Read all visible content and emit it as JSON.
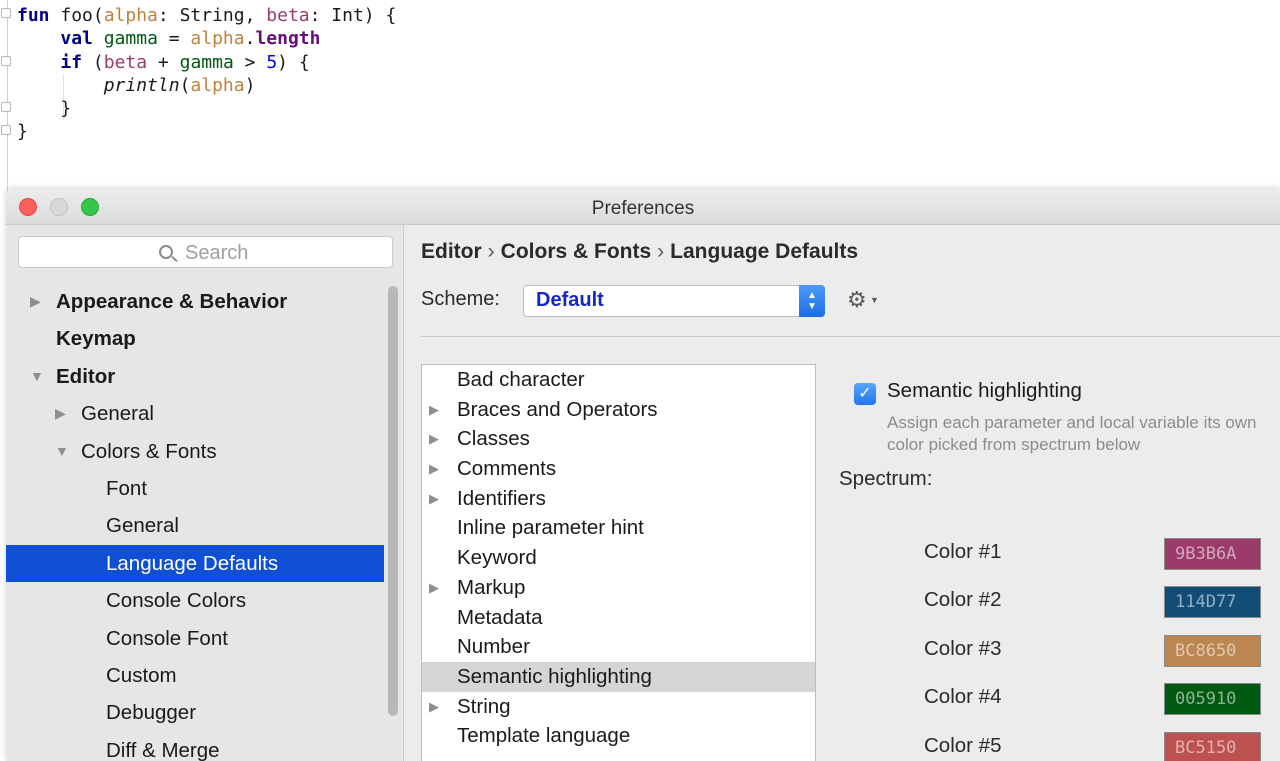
{
  "code": {
    "lines": [
      [
        {
          "t": "fun",
          "c": "kw"
        },
        {
          "t": " foo(",
          "c": ""
        },
        {
          "t": "alpha",
          "c": "p1"
        },
        {
          "t": ": String, ",
          "c": ""
        },
        {
          "t": "beta",
          "c": "p2"
        },
        {
          "t": ": Int) {",
          "c": ""
        }
      ],
      [
        {
          "t": "    ",
          "c": ""
        },
        {
          "t": "val",
          "c": "kw"
        },
        {
          "t": " ",
          "c": ""
        },
        {
          "t": "gamma",
          "c": "v3"
        },
        {
          "t": " = ",
          "c": ""
        },
        {
          "t": "alpha",
          "c": "p1"
        },
        {
          "t": ".",
          "c": ""
        },
        {
          "t": "length",
          "c": "fn"
        }
      ],
      [
        {
          "t": "    ",
          "c": ""
        },
        {
          "t": "if",
          "c": "kw"
        },
        {
          "t": " (",
          "c": ""
        },
        {
          "t": "beta",
          "c": "p2"
        },
        {
          "t": " + ",
          "c": ""
        },
        {
          "t": "gamma",
          "c": "v3"
        },
        {
          "t": " > ",
          "c": ""
        },
        {
          "t": "5",
          "c": "num"
        },
        {
          "t": ") {",
          "c": ""
        }
      ],
      [
        {
          "t": "        ",
          "c": ""
        },
        {
          "t": "println",
          "c": "it"
        },
        {
          "t": "(",
          "c": ""
        },
        {
          "t": "alpha",
          "c": "p1"
        },
        {
          "t": ")",
          "c": ""
        }
      ],
      [
        {
          "t": "    }",
          "c": ""
        }
      ],
      [
        {
          "t": "}",
          "c": ""
        }
      ]
    ]
  },
  "window": {
    "title": "Preferences"
  },
  "sidebar": {
    "search_placeholder": "Search",
    "items": [
      {
        "label": "Appearance & Behavior",
        "level": 0,
        "arrow": "right",
        "bold": true
      },
      {
        "label": "Keymap",
        "level": 0,
        "arrow": "",
        "bold": true
      },
      {
        "label": "Editor",
        "level": 0,
        "arrow": "down",
        "bold": true
      },
      {
        "label": "General",
        "level": 1,
        "arrow": "right",
        "bold": false
      },
      {
        "label": "Colors & Fonts",
        "level": 1,
        "arrow": "down",
        "bold": false
      },
      {
        "label": "Font",
        "level": 2,
        "arrow": "",
        "bold": false
      },
      {
        "label": "General",
        "level": 2,
        "arrow": "",
        "bold": false
      },
      {
        "label": "Language Defaults",
        "level": 2,
        "arrow": "",
        "bold": false,
        "selected": true
      },
      {
        "label": "Console Colors",
        "level": 2,
        "arrow": "",
        "bold": false
      },
      {
        "label": "Console Font",
        "level": 2,
        "arrow": "",
        "bold": false
      },
      {
        "label": "Custom",
        "level": 2,
        "arrow": "",
        "bold": false
      },
      {
        "label": "Debugger",
        "level": 2,
        "arrow": "",
        "bold": false
      },
      {
        "label": "Diff & Merge",
        "level": 2,
        "arrow": "",
        "bold": false
      }
    ]
  },
  "breadcrumb": {
    "part1": "Editor",
    "part2": "Colors & Fonts",
    "part3": "Language Defaults",
    "separator": "›"
  },
  "scheme": {
    "label": "Scheme:",
    "value": "Default"
  },
  "categories": [
    {
      "label": "Bad character",
      "expandable": false
    },
    {
      "label": "Braces and Operators",
      "expandable": true
    },
    {
      "label": "Classes",
      "expandable": true
    },
    {
      "label": "Comments",
      "expandable": true
    },
    {
      "label": "Identifiers",
      "expandable": true
    },
    {
      "label": "Inline parameter hint",
      "expandable": false
    },
    {
      "label": "Keyword",
      "expandable": false
    },
    {
      "label": "Markup",
      "expandable": true
    },
    {
      "label": "Metadata",
      "expandable": false
    },
    {
      "label": "Number",
      "expandable": false
    },
    {
      "label": "Semantic highlighting",
      "expandable": false,
      "selected": true
    },
    {
      "label": "String",
      "expandable": true
    },
    {
      "label": "Template language",
      "expandable": false
    }
  ],
  "semantic": {
    "checkbox_label": "Semantic highlighting",
    "checked": true,
    "description": "Assign each parameter and local variable its own color picked from spectrum below",
    "spectrum_label": "Spectrum:",
    "colors": [
      {
        "label": "Color #1",
        "hex": "9B3B6A"
      },
      {
        "label": "Color #2",
        "hex": "114D77"
      },
      {
        "label": "Color #3",
        "hex": "BC8650"
      },
      {
        "label": "Color #4",
        "hex": "005910"
      },
      {
        "label": "Color #5",
        "hex": "BC5150"
      }
    ]
  }
}
